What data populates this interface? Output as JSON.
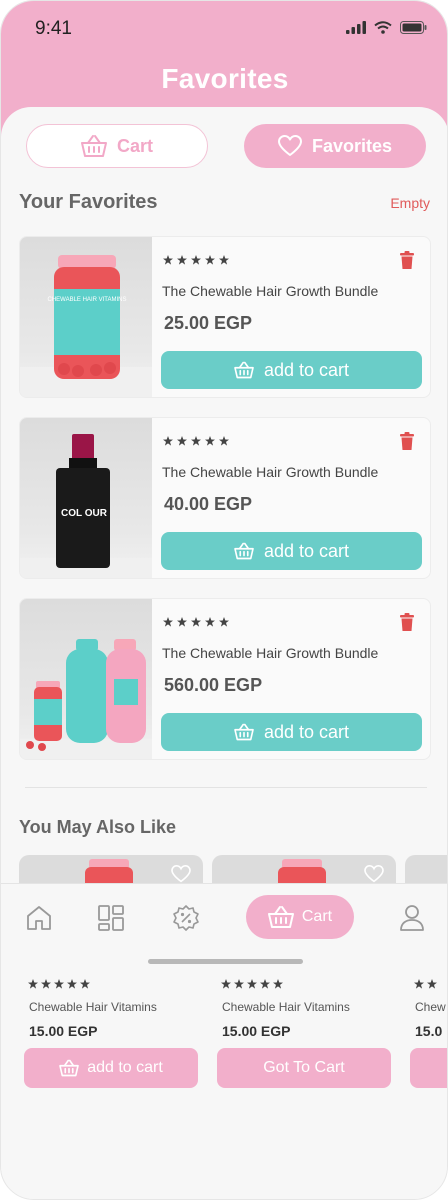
{
  "status": {
    "time": "9:41"
  },
  "header": {
    "title": "Favorites"
  },
  "segments": {
    "cart_label": "Cart",
    "favorites_label": "Favorites"
  },
  "favorites": {
    "title": "Your Favorites",
    "empty_label": "Empty",
    "add_label": "add to cart",
    "items": [
      {
        "name": "The Chewable Hair Growth Bundle",
        "price": "25.00 EGP",
        "rating": 5,
        "image_icon": "vitamin-jar-icon"
      },
      {
        "name": "The Chewable Hair Growth Bundle",
        "price": "40.00 EGP",
        "rating": 5,
        "image_icon": "nail-polish-icon"
      },
      {
        "name": "The Chewable Hair Growth Bundle",
        "price": "560.00 EGP",
        "rating": 5,
        "image_icon": "hair-bundle-icon"
      }
    ],
    "jar_label": "CHEWABLE HAIR VITAMINS",
    "polish_label": "COL OUR"
  },
  "recommend": {
    "title": "You May Also Like",
    "items": [
      {
        "name": "Chewable Hair Vitamins",
        "price": "15.00 EGP",
        "button": "add to cart"
      },
      {
        "name": "Chewable Hair Vitamins",
        "price": "15.00 EGP",
        "button": "Got To Cart"
      },
      {
        "name": "Chew",
        "price": "15.0",
        "button": ""
      }
    ]
  },
  "navbar": {
    "cart_label": "Cart"
  },
  "colors": {
    "pink": "#f2afcb",
    "teal": "#6acdc8",
    "danger": "#e05b5b"
  }
}
